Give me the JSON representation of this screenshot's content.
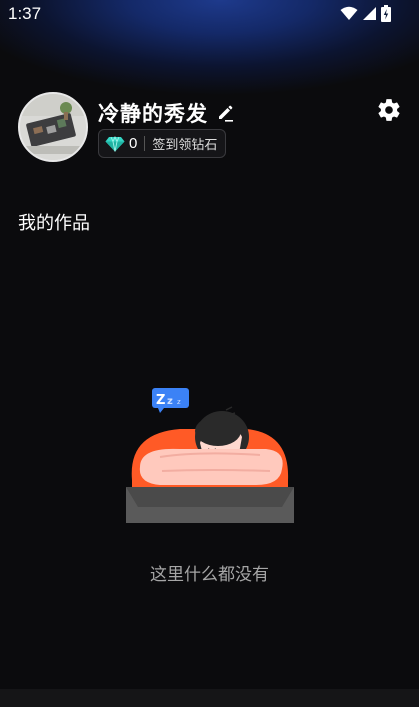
{
  "status_bar": {
    "time": "1:37",
    "icons": [
      "wifi-icon",
      "signal-icon",
      "battery-charging-icon"
    ]
  },
  "profile": {
    "nickname": "冷静的秀发",
    "diamond_count": "0",
    "checkin_label": "签到领钻石"
  },
  "section": {
    "title": "我的作品"
  },
  "empty_state": {
    "message": "这里什么都没有",
    "badge_text": "Z z z"
  },
  "colors": {
    "accent_diamond": "#33d6c4",
    "pillow": "#ff5a26",
    "background": "#0b0b0d",
    "header_glow": "#1e3a8c"
  }
}
